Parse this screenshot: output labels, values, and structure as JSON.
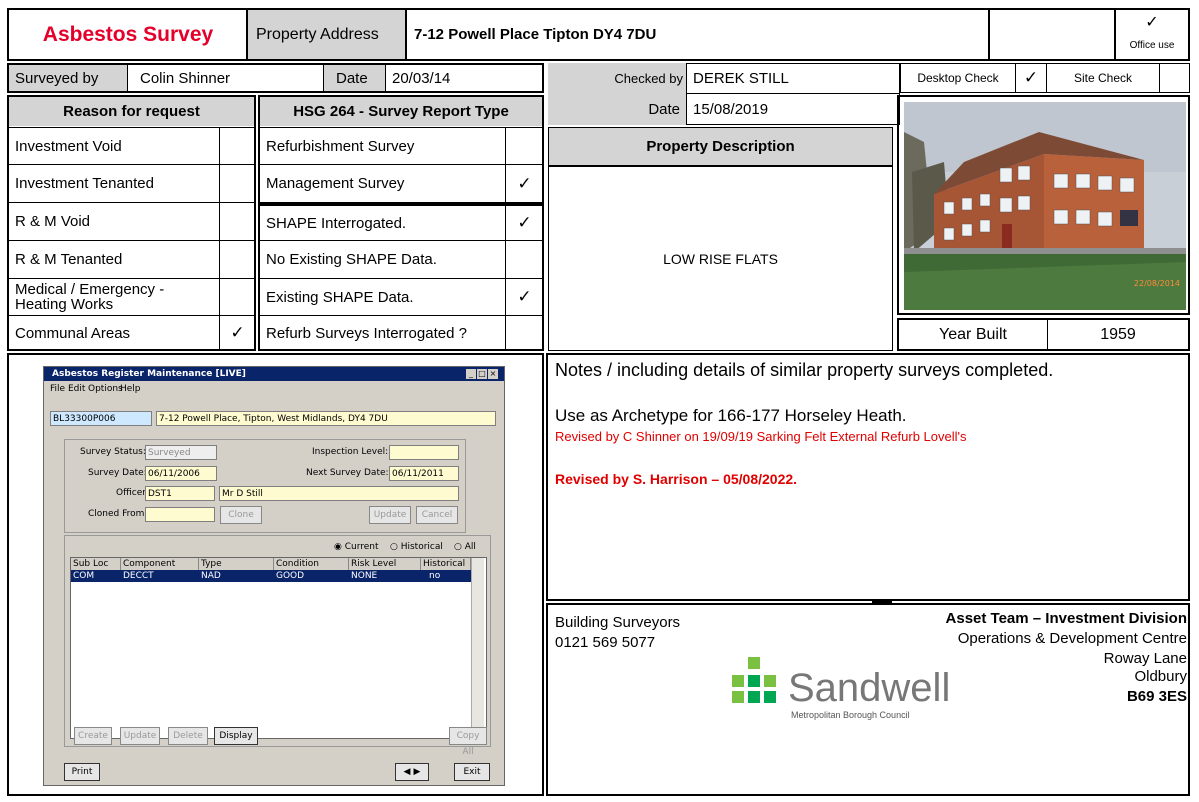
{
  "header": {
    "title": "Asbestos Survey",
    "property_address_label": "Property Address",
    "property_address": "7-12 Powell Place Tipton DY4 7DU",
    "office_tick": "✓",
    "office_use": "Office use"
  },
  "row2": {
    "surveyed_by_label": "Surveyed by",
    "surveyed_by": "Colin Shinner",
    "date_label": "Date",
    "date": "20/03/14",
    "checked_by_label": "Checked by",
    "checked_by": "DEREK STILL",
    "desktop_check_label": "Desktop Check",
    "desktop_check_tick": "✓",
    "site_check_label": "Site Check",
    "checked_date_label": "Date",
    "checked_date": "15/08/2019"
  },
  "reason": {
    "heading": "Reason for request",
    "items": [
      {
        "label": "Investment Void",
        "tick": ""
      },
      {
        "label": "Investment Tenanted",
        "tick": ""
      },
      {
        "label": "R & M Void",
        "tick": ""
      },
      {
        "label": "R & M Tenanted",
        "tick": ""
      },
      {
        "label": "Medical / Emergency -",
        "label2": "Heating Works",
        "tick": ""
      },
      {
        "label": "Communal Areas",
        "tick": "✓"
      }
    ]
  },
  "hsg": {
    "heading": "HSG 264 - Survey Report Type",
    "items": [
      {
        "label": "Refurbishment Survey",
        "tick": ""
      },
      {
        "label": "Management Survey",
        "tick": "✓"
      },
      {
        "label": "SHAPE Interrogated.",
        "tick": "✓"
      },
      {
        "label": "No Existing SHAPE Data.",
        "tick": ""
      },
      {
        "label": "Existing SHAPE Data.",
        "tick": "✓"
      },
      {
        "label": "Refurb Surveys Interrogated ?",
        "tick": ""
      }
    ]
  },
  "property": {
    "description_heading": "Property Description",
    "description": "LOW RISE FLATS",
    "photo_date": "22/08/2014",
    "year_built_label": "Year Built",
    "year_built": "1959"
  },
  "notes": {
    "heading": "Notes / including details of similar property surveys completed.",
    "archetype": "Use as Archetype for 166-177 Horseley Heath.",
    "revised1": "Revised by C Shinner on 19/09/19 Sarking Felt External Refurb Lovell's",
    "revised2": "Revised by S. Harrison – 05/08/2022."
  },
  "footer": {
    "dept": "Building Surveyors",
    "phone": "0121 569 5077",
    "team": "Asset Team – Investment Division",
    "addr1": "Operations & Development Centre",
    "addr2": "Roway Lane",
    "addr3": "Oldbury",
    "addr4": "B69 3ES",
    "logo_text": "Sandwell",
    "logo_sub": "Metropolitan Borough Council"
  },
  "app": {
    "title": "Asbestos Register Maintenance [LIVE]",
    "menu": [
      "File",
      "Edit",
      "Options",
      "Help"
    ],
    "ref": "BL33300P006",
    "address": "7-12 Powell Place, Tipton, West Midlands, DY4 7DU",
    "survey_status_label": "Survey Status:",
    "survey_status": "Surveyed",
    "inspection_level_label": "Inspection Level:",
    "inspection_level": "",
    "survey_date_label": "Survey Date:",
    "survey_date": "06/11/2006",
    "next_survey_label": "Next Survey Date:",
    "next_survey": "06/11/2011",
    "officer_label": "Officer:",
    "officer_code": "DST1",
    "officer_name": "Mr D Still",
    "cloned_label": "Cloned From:",
    "cloned": "",
    "clone_btn": "Clone",
    "update_btn": "Update",
    "cancel_btn": "Cancel",
    "radio_current": "Current",
    "radio_historical": "Historical",
    "radio_all": "All",
    "columns": [
      "Sub Loc",
      "Component",
      "Type",
      "Condition",
      "Risk Level",
      "Historical"
    ],
    "row": [
      "COM",
      "DECCT",
      "NAD",
      "GOOD",
      "NONE",
      "no"
    ],
    "btn_create": "Create",
    "btn_update": "Update",
    "btn_delete": "Delete",
    "btn_display": "Display",
    "btn_copyall": "Copy All",
    "btn_print": "Print",
    "btn_exit": "Exit"
  }
}
